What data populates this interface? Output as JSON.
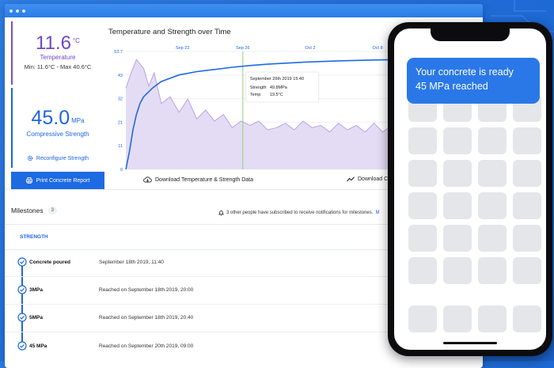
{
  "colors": {
    "background": "#2a78e8",
    "purple": "#6d49c6",
    "blue": "#1e66e0"
  },
  "temperature": {
    "value": "11.6",
    "unit": "°C",
    "label": "Temperature",
    "range": "Min: 11.6°C - Max 40.6°C"
  },
  "strength": {
    "value": "45.0",
    "unit": "MPa",
    "label": "Compressive Strength",
    "reconfigure_label": "Reconfigure Strength"
  },
  "actions": {
    "print_label": "Print Concrete Report",
    "download_temp_label": "Download Temperature & Strength Data",
    "download_chart_label": "Download Cha"
  },
  "chart_data": {
    "type": "line",
    "title": "Temperature and Strength over Time",
    "x_ticks": [
      "Sep 22",
      "Sep 26",
      "Oct 2",
      "Oct 8"
    ],
    "y_ticks": [
      "0",
      "11",
      "21",
      "32",
      "43",
      "53.7"
    ],
    "ylim": [
      0,
      53.7
    ],
    "x_range_days": [
      0,
      20
    ],
    "temperature_series": {
      "name": "Temp",
      "x": [
        0,
        0.3,
        0.6,
        1.0,
        1.3,
        1.6,
        2.0,
        2.5,
        3.0,
        3.5,
        4.0,
        4.5,
        5.0,
        5.5,
        6.0,
        6.5,
        7.0,
        7.5,
        8.0,
        8.5,
        9.0,
        9.5,
        10.0,
        10.5,
        11.0,
        11.5,
        12.0,
        12.5,
        13.0,
        13.5,
        14.0,
        14.5,
        15.0,
        15.5,
        16.0,
        16.5,
        17.0,
        17.5,
        18.0,
        18.5,
        19.0,
        19.5,
        20.0
      ],
      "values": [
        37,
        44,
        50,
        46,
        38,
        44,
        30,
        33,
        26,
        32,
        23,
        27,
        22,
        25,
        19,
        22,
        20,
        22,
        18,
        19,
        21,
        18,
        22,
        19,
        20,
        17,
        21,
        18,
        20,
        17,
        21,
        17,
        20,
        16,
        20,
        18,
        17,
        20,
        16,
        19,
        17,
        18,
        16
      ]
    },
    "strength_series": {
      "name": "Strength",
      "x": [
        0,
        0.2,
        0.4,
        0.6,
        0.8,
        1.0,
        1.5,
        2.0,
        3.0,
        4.0,
        5.0,
        6.0,
        7.0,
        8.0,
        10.0,
        12.0,
        14.0,
        16.0,
        18.0,
        20.0
      ],
      "values": [
        0,
        8,
        18,
        25,
        30,
        33,
        37,
        40,
        43,
        44.5,
        45.5,
        46.5,
        47.3,
        47.9,
        48.8,
        49.4,
        49.8,
        50.1,
        50.4,
        50.6
      ]
    },
    "marker_x": 6.6,
    "tooltip": {
      "date": "September 26th 2019 15:40",
      "strength_label": "Strength",
      "strength_value": "49.8MPa",
      "temp_label": "Temp",
      "temp_value": "19.5°C"
    }
  },
  "milestones": {
    "title": "Milestones",
    "count": "3",
    "notify_text": "3 other people have subscribed to receive notifications for milestones.",
    "notify_link": "M",
    "section_title": "STRENGTH",
    "items": [
      {
        "name": "Concrete poured",
        "date": "September 18th 2019, 11:40"
      },
      {
        "name": "3MPa",
        "date": "Reached on September 18th 2019, 20:00"
      },
      {
        "name": "5MPa",
        "date": "Reached on September 18th 2019, 20:40"
      },
      {
        "name": "45 MPa",
        "date": "Reached on September 20th 2019, 09:00"
      }
    ]
  },
  "phone": {
    "notification_line1": "Your concrete is ready",
    "notification_line2": "45 MPa reached"
  }
}
